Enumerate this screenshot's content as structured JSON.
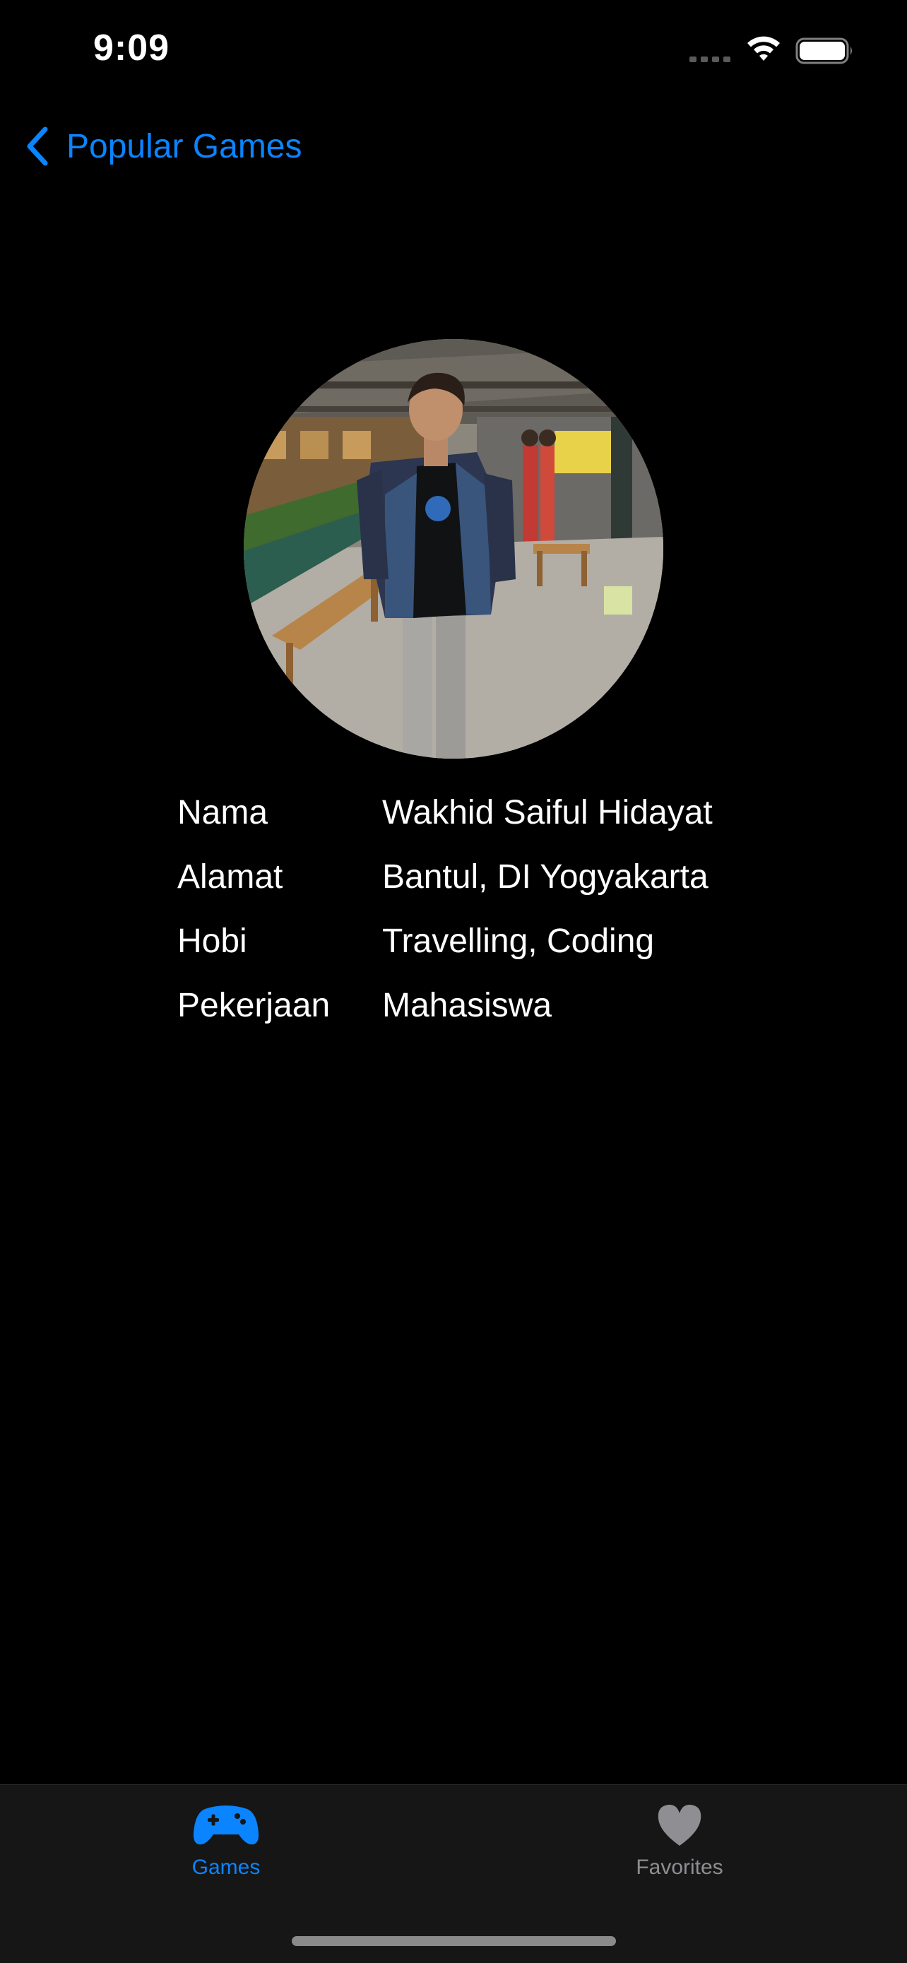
{
  "status_bar": {
    "time": "9:09"
  },
  "nav": {
    "back_label": "Popular Games"
  },
  "profile": {
    "rows": [
      {
        "key": "Nama",
        "value": "Wakhid Saiful Hidayat"
      },
      {
        "key": "Alamat",
        "value": "Bantul, DI Yogyakarta"
      },
      {
        "key": "Hobi",
        "value": "Travelling, Coding"
      },
      {
        "key": "Pekerjaan",
        "value": "Mahasiswa"
      }
    ]
  },
  "tab_bar": {
    "items": [
      {
        "label": "Games",
        "icon": "gamecontroller-icon",
        "selected": true
      },
      {
        "label": "Favorites",
        "icon": "heart-icon",
        "selected": false
      }
    ]
  },
  "colors": {
    "accent": "#0a84ff",
    "background": "#000000",
    "tab_bar_bg": "#161616",
    "inactive_tab": "#8e8e93"
  }
}
